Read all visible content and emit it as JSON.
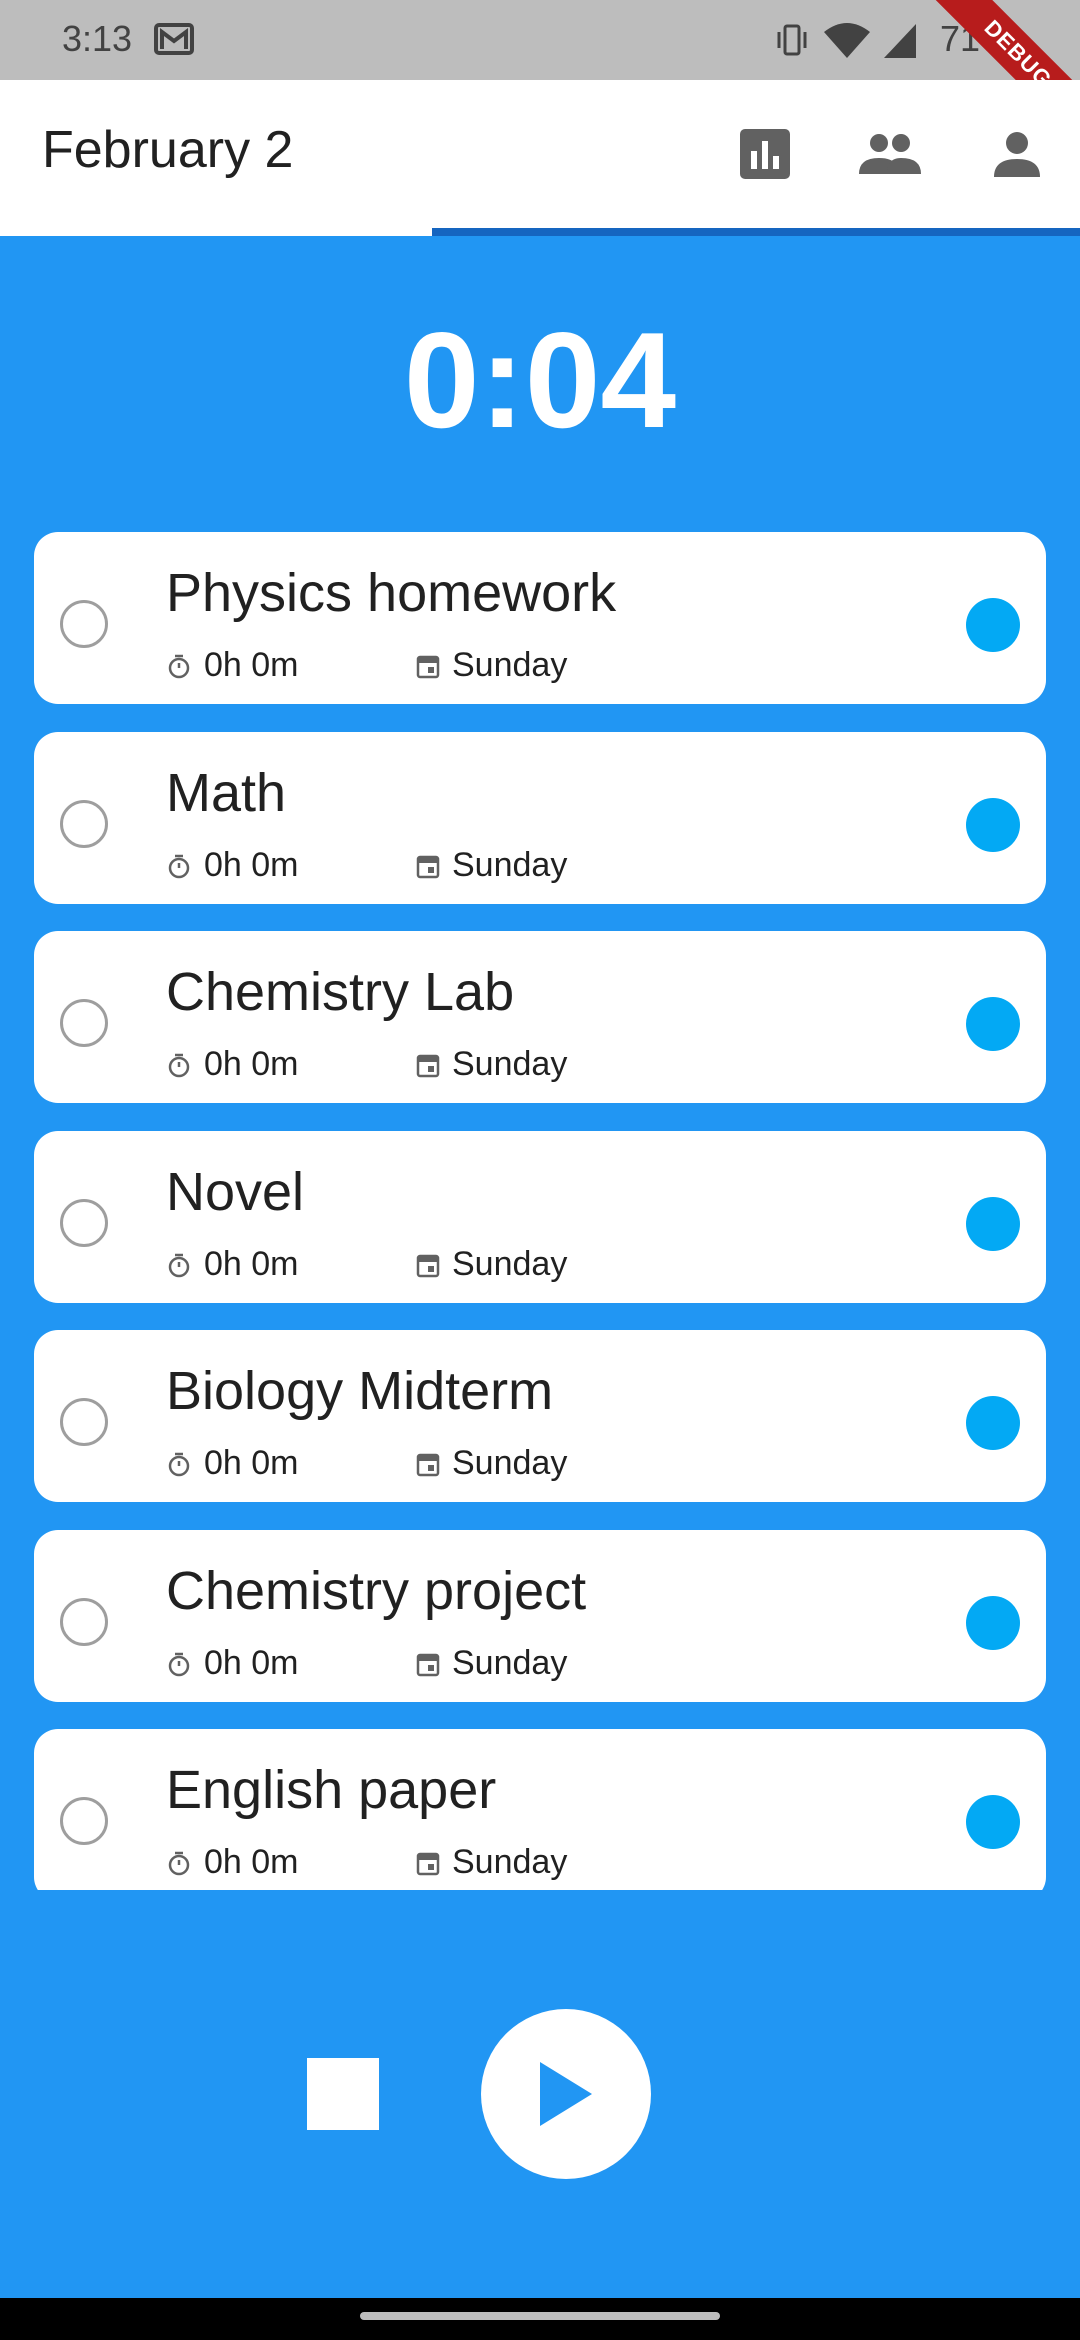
{
  "status_bar": {
    "time": "3:13",
    "battery": "71%",
    "debug_label": "DEBUG"
  },
  "app_bar": {
    "title": "February 2",
    "icons": [
      "stats-icon",
      "people-icon",
      "person-icon"
    ]
  },
  "timer": {
    "display": "0:04"
  },
  "tasks": [
    {
      "title": "Physics homework",
      "duration": "0h 0m",
      "day": "Sunday"
    },
    {
      "title": "Math",
      "duration": "0h 0m",
      "day": "Sunday"
    },
    {
      "title": "Chemistry Lab",
      "duration": "0h 0m",
      "day": "Sunday"
    },
    {
      "title": "Novel",
      "duration": "0h 0m",
      "day": "Sunday"
    },
    {
      "title": "Biology Midterm",
      "duration": "0h 0m",
      "day": "Sunday"
    },
    {
      "title": "Chemistry project",
      "duration": "0h 0m",
      "day": "Sunday"
    },
    {
      "title": "English paper",
      "duration": "0h 0m",
      "day": "Sunday"
    }
  ],
  "colors": {
    "background": "#2196F3",
    "tab_indicator": "#1565C0",
    "task_dot": "#03A9F4",
    "debug_banner": "#B71C1C"
  },
  "controls": {
    "stop": "stop-icon",
    "play": "play-icon"
  }
}
